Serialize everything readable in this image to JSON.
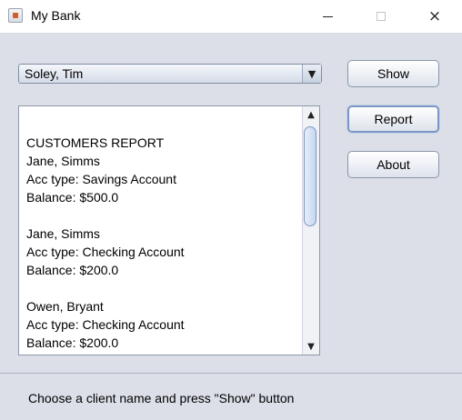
{
  "window": {
    "title": "My Bank",
    "app_icon": "java-icon",
    "controls": {
      "minimize": "minimize-icon",
      "maximize": "maximize-icon",
      "close": "×"
    }
  },
  "client_select": {
    "selected": "Soley, Tim",
    "arrow": "▼"
  },
  "buttons": {
    "show": "Show",
    "report": "Report",
    "about": "About"
  },
  "report": {
    "lines": [
      "CUSTOMERS REPORT",
      "Jane, Simms",
      "Acc type: Savings Account",
      "Balance: $500.0",
      "",
      "Jane, Simms",
      "Acc type: Checking Account",
      "Balance: $200.0",
      "",
      "Owen, Bryant",
      "Acc type: Checking Account",
      "Balance: $200.0"
    ],
    "scroll_up": "▲",
    "scroll_down": "▼"
  },
  "status": {
    "text": "Choose a client name and press \"Show\" button"
  },
  "colors": {
    "background": "#dcdfe8",
    "focus_border": "#7d97c2"
  }
}
